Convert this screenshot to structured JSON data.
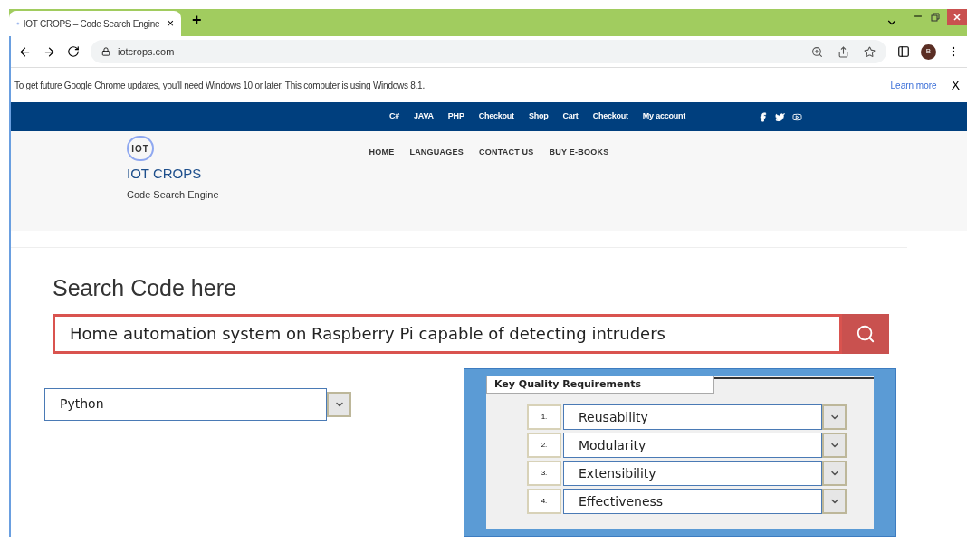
{
  "browser": {
    "tab_title": "IOT CROPS – Code Search Engine",
    "tab_close": "×",
    "new_tab": "+",
    "url": "iotcrops.com",
    "profile": "B"
  },
  "infobar": {
    "message": "To get future Google Chrome updates, you'll need Windows 10 or later. This computer is using Windows 8.1.",
    "link": "Learn more",
    "close": "X"
  },
  "topbar": {
    "links": [
      "C#",
      "JAVA",
      "PHP",
      "Checkout",
      "Shop",
      "Cart",
      "Checkout",
      "My account"
    ]
  },
  "header": {
    "logo_text": "IOT",
    "site_name": "IOT CROPS",
    "tagline": "Code Search Engine",
    "nav": [
      "HOME",
      "LANGUAGES",
      "CONTACT US",
      "BUY E-BOOKS"
    ]
  },
  "search": {
    "heading": "Search Code here",
    "value": "Home automation system on Raspberry Pi capable of detecting intruders"
  },
  "language": {
    "value": "Python"
  },
  "requirements": {
    "title": "Key Quality Requirements",
    "items": [
      {
        "number": "1.",
        "value": "Reusability"
      },
      {
        "number": "2.",
        "value": "Modularity"
      },
      {
        "number": "3.",
        "value": "Extensibility"
      },
      {
        "number": "4.",
        "value": "Effectiveness"
      }
    ]
  }
}
